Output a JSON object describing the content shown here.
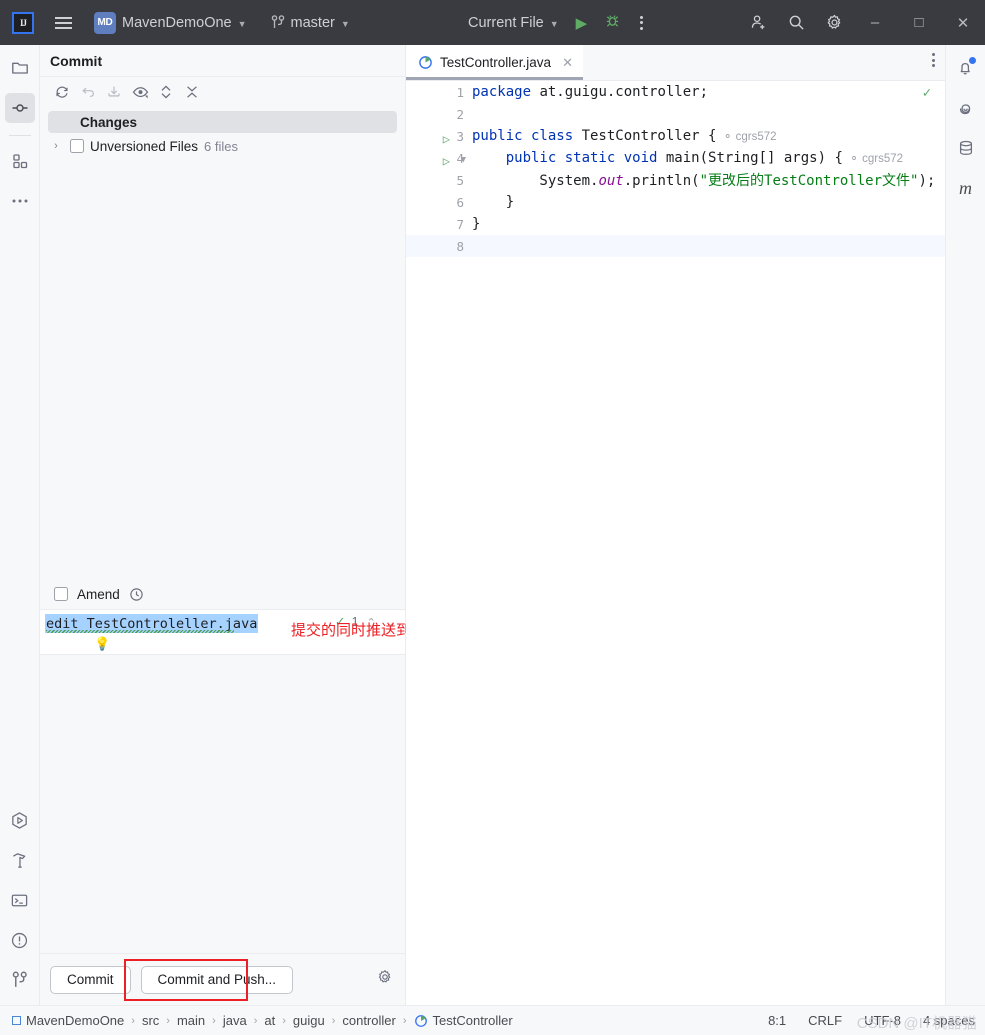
{
  "titlebar": {
    "logo": "IJ",
    "menu_icon": "hamburger-menu-icon",
    "project_badge": "MD",
    "project_name": "MavenDemoOne",
    "branch_name": "master",
    "run_config": "Current File",
    "run_icon": "run-icon",
    "debug_icon": "debug-icon",
    "more_icon": "more-options-icon",
    "account_icon": "add-account-icon",
    "search_icon": "search-icon",
    "settings_icon": "gear-icon",
    "minimize": "–",
    "maximize": "□",
    "close": "✕"
  },
  "left_stripe": {
    "top": [
      {
        "name": "project-tool-window",
        "icon": "folder-icon",
        "active": false
      },
      {
        "name": "commit-tool-window",
        "icon": "commit-node-icon",
        "active": true
      },
      {
        "name": "structure-tool-window",
        "icon": "structure-squares-icon",
        "active": false
      },
      {
        "name": "more-tool-windows",
        "icon": "ellipsis-icon",
        "active": false
      }
    ],
    "bottom": [
      {
        "name": "run-tool-window",
        "icon": "run-hexagon-icon"
      },
      {
        "name": "build-tool-window",
        "icon": "hammer-icon"
      },
      {
        "name": "terminal-tool-window",
        "icon": "terminal-icon"
      },
      {
        "name": "problems-tool-window",
        "icon": "warning-circle-icon"
      },
      {
        "name": "git-tool-window",
        "icon": "git-branch-icon"
      }
    ]
  },
  "right_stripe": [
    {
      "name": "notifications",
      "icon": "bell-icon",
      "badge": true
    },
    {
      "name": "ai-assistant",
      "icon": "spiral-icon",
      "badge": false
    },
    {
      "name": "database",
      "icon": "database-icon",
      "badge": false
    },
    {
      "name": "maven",
      "icon": "maven-m-icon",
      "badge": false
    }
  ],
  "commit_panel": {
    "title": "Commit",
    "toolbar": [
      {
        "name": "refresh-changes-button",
        "icon": "refresh-icon"
      },
      {
        "name": "rollback-button",
        "icon": "rollback-icon"
      },
      {
        "name": "update-project-button",
        "icon": "download-icon"
      },
      {
        "name": "show-diff-button",
        "icon": "eye-icon"
      },
      {
        "name": "expand-collapse-button",
        "icon": "expand-collapse-icon"
      },
      {
        "name": "collapse-all-button",
        "icon": "collapse-all-icon"
      }
    ],
    "changes_group": "Changes",
    "unversioned": {
      "label": "Unversioned Files",
      "count": "6 files",
      "expand_arrow": "›"
    },
    "amend": {
      "label": "Amend",
      "history_icon": "clock-history-icon"
    },
    "message": {
      "value": "edit TestControleller.java",
      "inspection_count": "1",
      "inspection_icon": "inspection-ok-icon",
      "up_arrow": "⌃",
      "down_arrow": "⌄",
      "bulb_icon": "lightbulb-icon"
    },
    "annotation": "提交的同时推送到远程仓库",
    "annotation_color": "#ec2024",
    "commit_button": "Commit",
    "commit_push_button": "Commit and Push...",
    "settings_icon": "gear-icon"
  },
  "editor": {
    "tab": {
      "name": "TestController.java",
      "file_icon": "java-class-icon",
      "close_icon": "close-icon"
    },
    "kebab_icon": "editor-options-icon",
    "analysis_status_icon": "inspections-ok-check-icon",
    "lines": [
      {
        "num": "1",
        "gutter_run": false,
        "gutter_fold": false,
        "current": false,
        "tokens": [
          {
            "t": "package ",
            "c": "kw"
          },
          {
            "t": "at.guigu.controller;",
            "c": "pl"
          }
        ],
        "author": ""
      },
      {
        "num": "2",
        "gutter_run": false,
        "gutter_fold": false,
        "current": false,
        "tokens": [],
        "author": ""
      },
      {
        "num": "3",
        "gutter_run": true,
        "gutter_fold": false,
        "current": false,
        "tokens": [
          {
            "t": "public class ",
            "c": "kw"
          },
          {
            "t": "TestController {",
            "c": "pl"
          }
        ],
        "author": "cgrs572"
      },
      {
        "num": "4",
        "gutter_run": true,
        "gutter_fold": true,
        "current": false,
        "tokens": [
          {
            "t": "    public static void ",
            "c": "kw"
          },
          {
            "t": "main(String[] args) {",
            "c": "pl"
          }
        ],
        "author": "cgrs572"
      },
      {
        "num": "5",
        "gutter_run": false,
        "gutter_fold": false,
        "current": false,
        "tokens": [
          {
            "t": "        System.",
            "c": "pl"
          },
          {
            "t": "out",
            "c": "fld"
          },
          {
            "t": ".println(",
            "c": "pl"
          },
          {
            "t": "\"更改后的TestController文件\"",
            "c": "str"
          },
          {
            "t": ");",
            "c": "pl"
          }
        ],
        "author": ""
      },
      {
        "num": "6",
        "gutter_run": false,
        "gutter_fold": false,
        "current": false,
        "tokens": [
          {
            "t": "    }",
            "c": "pl"
          }
        ],
        "author": ""
      },
      {
        "num": "7",
        "gutter_run": false,
        "gutter_fold": false,
        "current": false,
        "tokens": [
          {
            "t": "}",
            "c": "pl"
          }
        ],
        "author": ""
      },
      {
        "num": "8",
        "gutter_run": false,
        "gutter_fold": false,
        "current": true,
        "tokens": [],
        "author": ""
      }
    ]
  },
  "statusbar": {
    "breadcrumbs": [
      {
        "label": "MavenDemoOne",
        "icon": "module-icon"
      },
      {
        "label": "src",
        "icon": ""
      },
      {
        "label": "main",
        "icon": ""
      },
      {
        "label": "java",
        "icon": ""
      },
      {
        "label": "at",
        "icon": ""
      },
      {
        "label": "guigu",
        "icon": ""
      },
      {
        "label": "controller",
        "icon": ""
      },
      {
        "label": "TestController",
        "icon": "java-class-icon"
      }
    ],
    "separator": "›",
    "caret_position": "8:1",
    "line_separator": "CRLF",
    "encoding": "UTF-8",
    "indent": "4 spaces",
    "watermark": "CSDN @IT机器猫"
  }
}
